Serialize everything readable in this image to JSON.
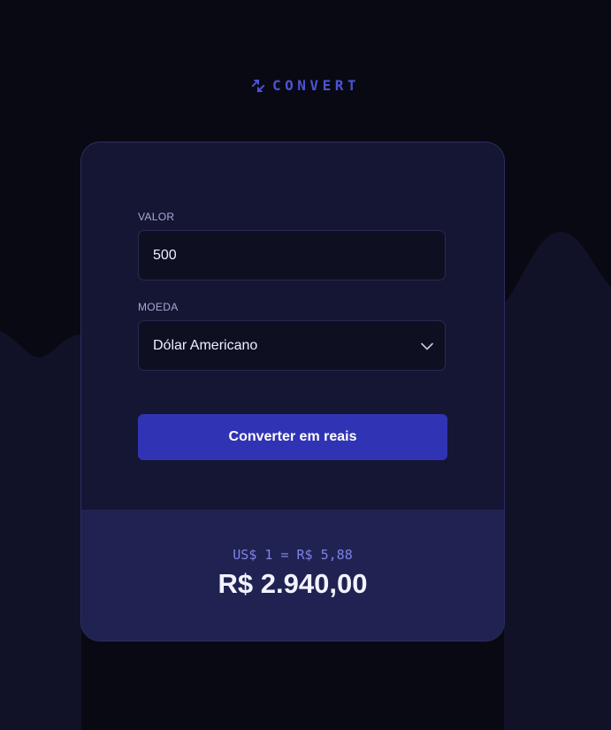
{
  "brand": {
    "name": "CONVERT",
    "icon": "arrows-exchange-icon",
    "color": "#4d52d6"
  },
  "form": {
    "amount": {
      "label": "VALOR",
      "value": "500"
    },
    "currency": {
      "label": "MOEDA",
      "selected": "Dólar Americano",
      "icon": "chevron-down-icon"
    },
    "submit_label": "Converter em reais"
  },
  "result": {
    "rate": "US$ 1 = R$ 5,88",
    "total": "R$ 2.940,00"
  },
  "colors": {
    "background": "#090913",
    "card": "#151633",
    "result_panel": "#202251",
    "button": "#3034b4"
  }
}
